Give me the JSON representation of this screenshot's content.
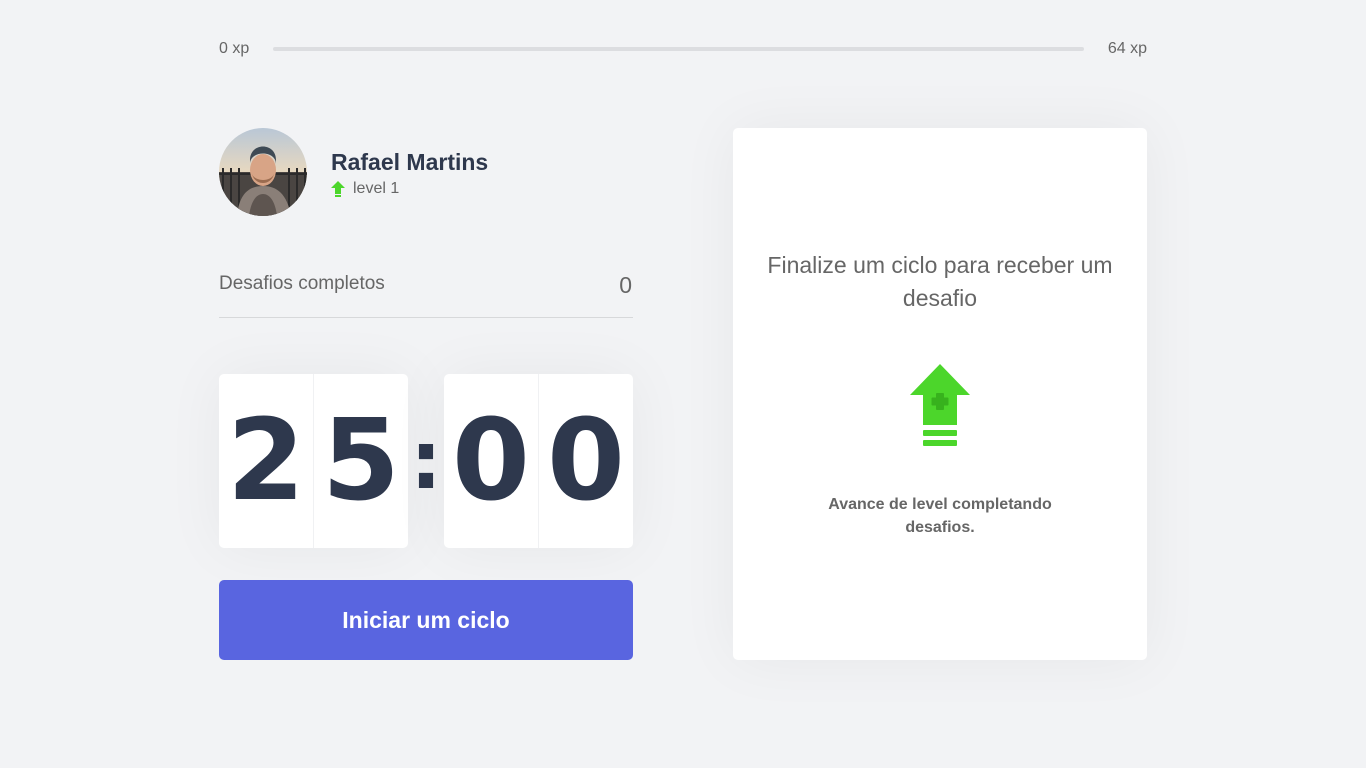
{
  "xp": {
    "current_label": "0 xp",
    "next_label": "64 xp",
    "progress_fraction": 0,
    "fill_color": "#4cd62b"
  },
  "profile": {
    "name": "Rafael Martins",
    "level_label": "level 1",
    "level_icon": "level-up-arrow-icon",
    "avatar_icon": "user-avatar-photo"
  },
  "completed_challenges": {
    "label": "Desafios completos",
    "count": "0"
  },
  "countdown": {
    "minute_left": "2",
    "minute_right": "5",
    "separator": ":",
    "second_left": "0",
    "second_right": "0"
  },
  "start_button": {
    "label": "Iniciar um ciclo",
    "color": "#5965e0"
  },
  "challenge_box": {
    "title": "Finalize um ciclo para receber um desafio",
    "icon": "level-up-arrow-icon",
    "description": "Avance de level completando desafios.",
    "accent_color": "#4cd62b"
  }
}
